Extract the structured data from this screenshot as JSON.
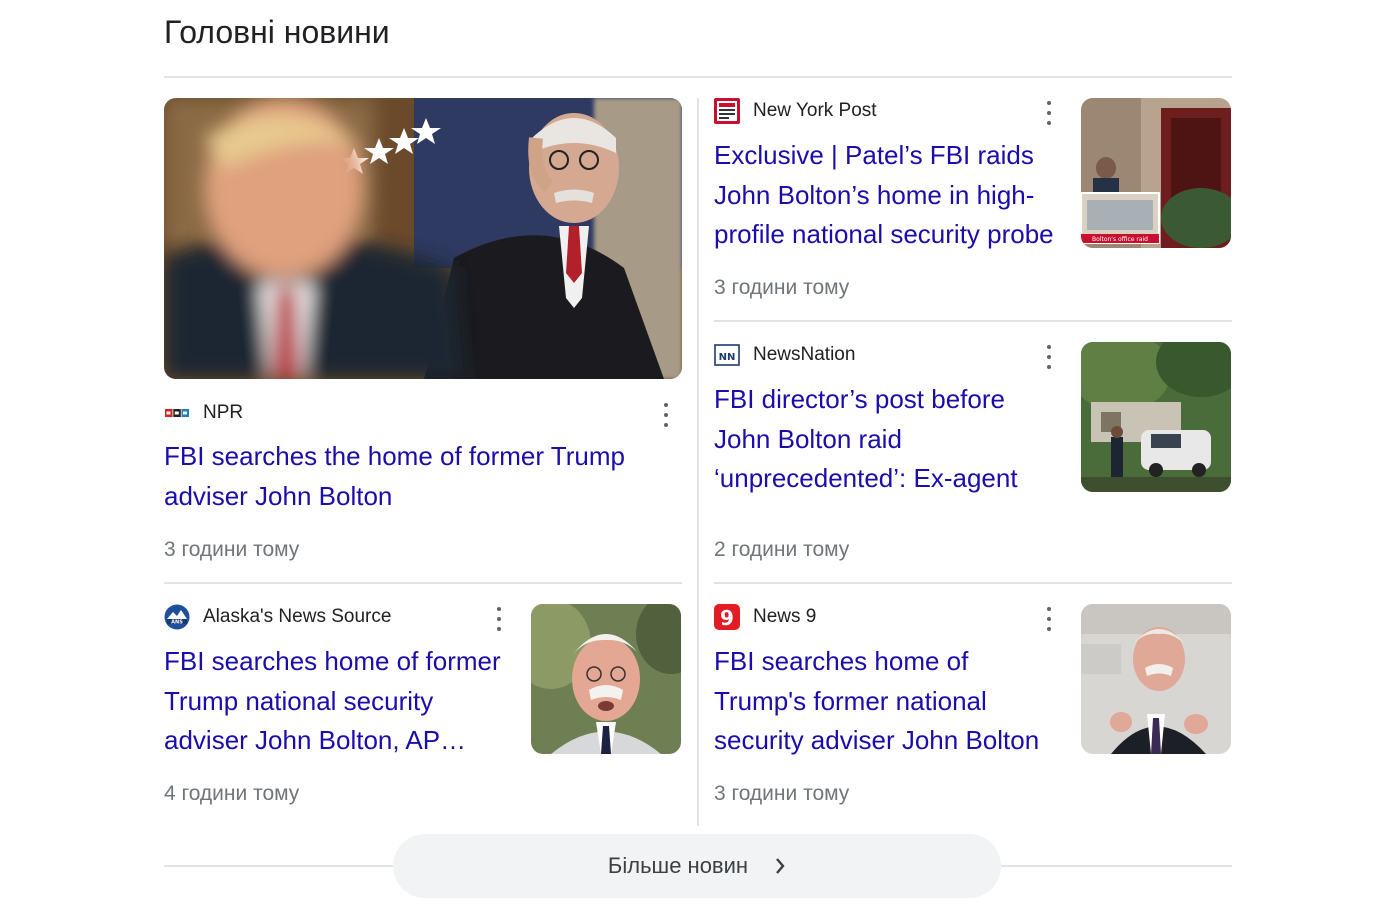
{
  "section": {
    "title": "Головні новини"
  },
  "articles": [
    {
      "source": "NPR",
      "logo_icon": "npr-logo-icon",
      "headline": "FBI searches the home of former Trump adviser John Bolton",
      "time": "3 години тому"
    },
    {
      "source": "New York Post",
      "logo_icon": "new-york-post-logo-icon",
      "headline": "Exclusive | Patel’s FBI raids John Bolton’s home in high-profile national security probe",
      "time": "3 години тому",
      "thumb_caption": "Bolton's office raid"
    },
    {
      "source": "NewsNation",
      "logo_icon": "newsnation-logo-icon",
      "headline": "FBI director’s post before John Bolton raid ‘unprecedented’: Ex-agent",
      "time": "2 години тому"
    },
    {
      "source": "Alaska's News Source",
      "logo_icon": "alaskas-news-source-logo-icon",
      "headline": "FBI searches home of former Trump national security adviser John Bolton, AP…",
      "time": "4 години тому"
    },
    {
      "source": "News 9",
      "logo_icon": "news9-logo-icon",
      "headline": "FBI searches home of Trump's former national security adviser John Bolton",
      "time": "3 години тому"
    }
  ],
  "footer": {
    "more_label": "Більше новин"
  },
  "colors": {
    "link": "#1a0dab",
    "meta": "#70757a",
    "divider": "#e3e3e3",
    "button_bg": "#f1f3f4"
  }
}
